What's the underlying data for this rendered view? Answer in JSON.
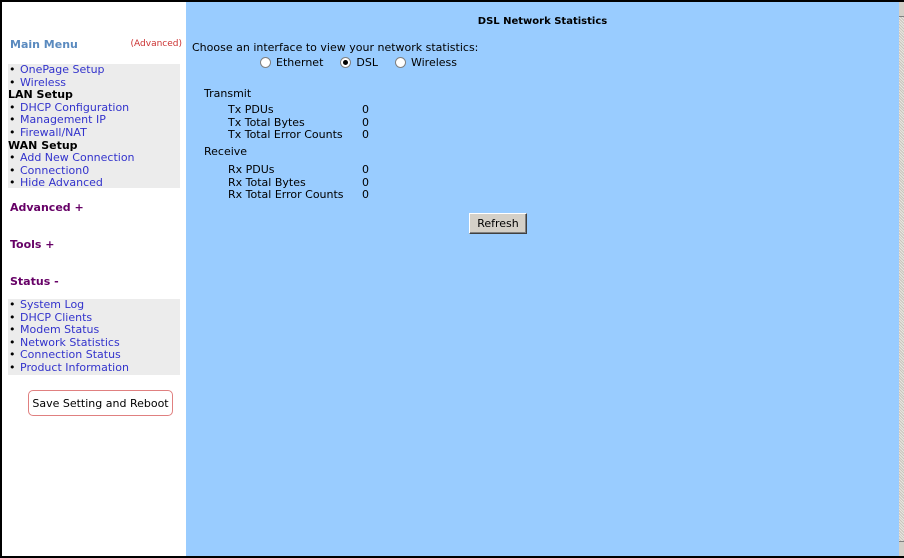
{
  "page": {
    "title": "DSL Network Statistics",
    "prompt": "Choose an interface to view your network statistics:",
    "interfaces": [
      {
        "label": "Ethernet",
        "selected": false
      },
      {
        "label": "DSL",
        "selected": true
      },
      {
        "label": "Wireless",
        "selected": false
      }
    ],
    "transmit": {
      "title": "Transmit",
      "rows": [
        {
          "label": "Tx PDUs",
          "value": "0"
        },
        {
          "label": "Tx Total Bytes",
          "value": "0"
        },
        {
          "label": "Tx Total Error Counts",
          "value": "0"
        }
      ]
    },
    "receive": {
      "title": "Receive",
      "rows": [
        {
          "label": "Rx PDUs",
          "value": "0"
        },
        {
          "label": "Rx Total Bytes",
          "value": "0"
        },
        {
          "label": "Rx Total Error Counts",
          "value": "0"
        }
      ]
    },
    "refresh_label": "Refresh"
  },
  "sidebar": {
    "main_menu": "Main Menu",
    "advanced_tag": "(Advanced)",
    "bullet": "•",
    "menu": {
      "onepage": "OnePage Setup",
      "wireless": "Wireless",
      "lan_setup": "LAN Setup",
      "dhcp_config": "DHCP Configuration",
      "management_ip": "Management IP",
      "firewall_nat": "Firewall/NAT",
      "wan_setup": "WAN Setup",
      "add_connection": "Add New Connection",
      "connection0": "Connection0",
      "hide_advanced": "Hide Advanced"
    },
    "advanced": "Advanced +",
    "tools": "Tools +",
    "status": "Status -",
    "status_items": {
      "system_log": "System Log",
      "dhcp_clients": "DHCP Clients",
      "modem_status": "Modem Status",
      "network_statistics": "Network Statistics",
      "connection_status": "Connection Status",
      "product_information": "Product Information"
    },
    "save_reboot": "Save Setting and Reboot"
  },
  "colors": {
    "content_bg": "#99ccff",
    "link": "#3333cc",
    "section": "#660066",
    "main_menu": "#5a8abf",
    "advanced_tag": "#cc3333"
  }
}
